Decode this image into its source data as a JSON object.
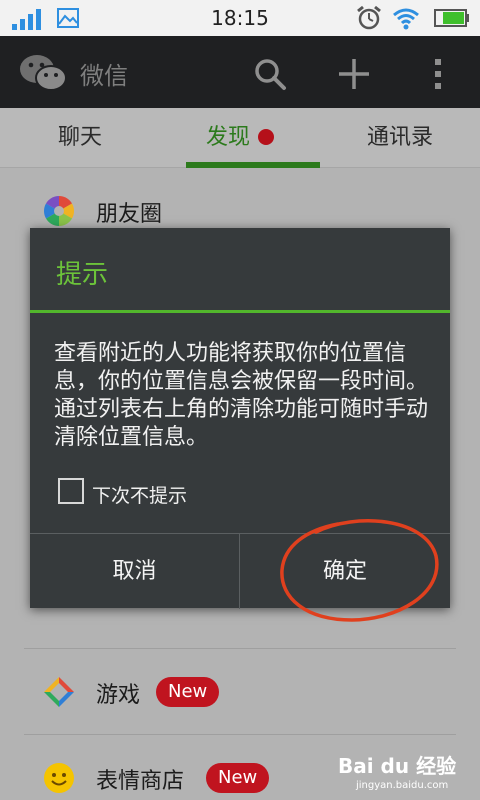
{
  "status_bar": {
    "time": "18:15",
    "icons": [
      "signal-icon",
      "gallery-icon",
      "alarm-icon",
      "wifi-icon",
      "battery-icon"
    ]
  },
  "header": {
    "title": "微信",
    "icons": [
      "wechat-logo-icon",
      "search-icon",
      "plus-icon",
      "more-icon"
    ]
  },
  "tabs": [
    {
      "label": "聊天",
      "active": false
    },
    {
      "label": "发现",
      "active": true,
      "has_dot": true
    },
    {
      "label": "通讯录",
      "active": false
    }
  ],
  "discover_list": [
    {
      "label": "朋友圈",
      "icon": "moments-icon"
    },
    {
      "label": "游戏",
      "icon": "game-icon",
      "badge": "New"
    },
    {
      "label": "表情商店",
      "icon": "sticker-icon",
      "badge": "New"
    }
  ],
  "dialog": {
    "title": "提示",
    "message": "查看附近的人功能将获取你的位置信息，你的位置信息会被保留一段时间。通过列表右上角的清除功能可随时手动清除位置信息。",
    "checkbox_label": "下次不提示",
    "checkbox_checked": false,
    "cancel_label": "取消",
    "ok_label": "确定"
  },
  "colors": {
    "accent_green": "#6cc33a",
    "tab_green": "#2c7a1c",
    "badge_red": "#c0141f",
    "annotation_red": "#e0401e",
    "title_bar": "#1f2022",
    "dialog_bg": "#363a3c"
  },
  "watermark": {
    "text": "Bai du 经验",
    "url": "jingyan.baidu.com"
  }
}
